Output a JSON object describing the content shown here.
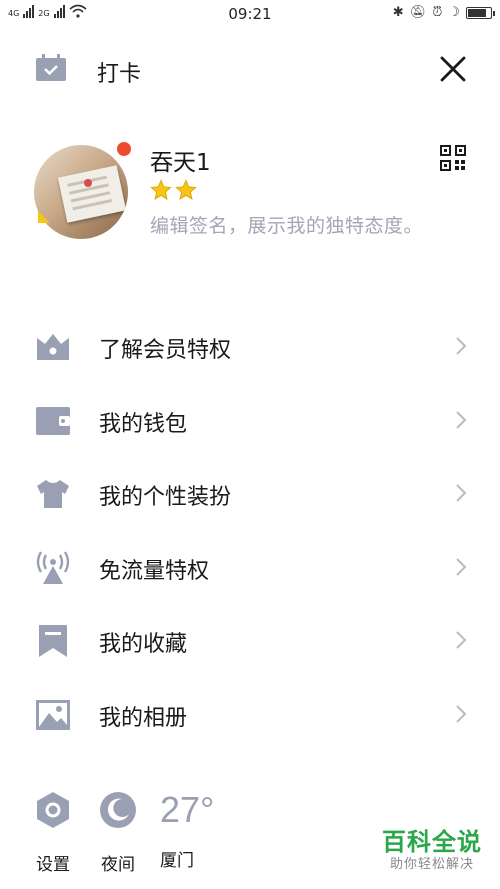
{
  "status_bar": {
    "network_1": "4G",
    "network_2": "2G",
    "time": "09:21",
    "battery_level": 0.85
  },
  "header": {
    "checkin_label": "打卡"
  },
  "profile": {
    "username": "吞天1",
    "star_count": 2,
    "signature": "编辑签名，展示我的独特态度。"
  },
  "menu": {
    "items": [
      {
        "label": "了解会员特权",
        "icon": "crown-icon"
      },
      {
        "label": "我的钱包",
        "icon": "wallet-icon"
      },
      {
        "label": "我的个性装扮",
        "icon": "tshirt-icon"
      },
      {
        "label": "免流量特权",
        "icon": "signal-tower-icon"
      },
      {
        "label": "我的收藏",
        "icon": "bookmark-icon"
      },
      {
        "label": "我的相册",
        "icon": "photo-icon"
      }
    ]
  },
  "bottom_bar": {
    "settings_label": "设置",
    "night_label": "夜间",
    "temperature": "27°",
    "city_label": "厦门"
  },
  "watermark": {
    "title": "百科全说",
    "subtitle": "助你轻松解决"
  },
  "colors": {
    "icon_gray": "#9aa0b4",
    "accent_red": "#f04a2c",
    "star_yellow": "#f5c518",
    "hint_gray": "#a3a6b4",
    "watermark_green": "#2aa748"
  }
}
